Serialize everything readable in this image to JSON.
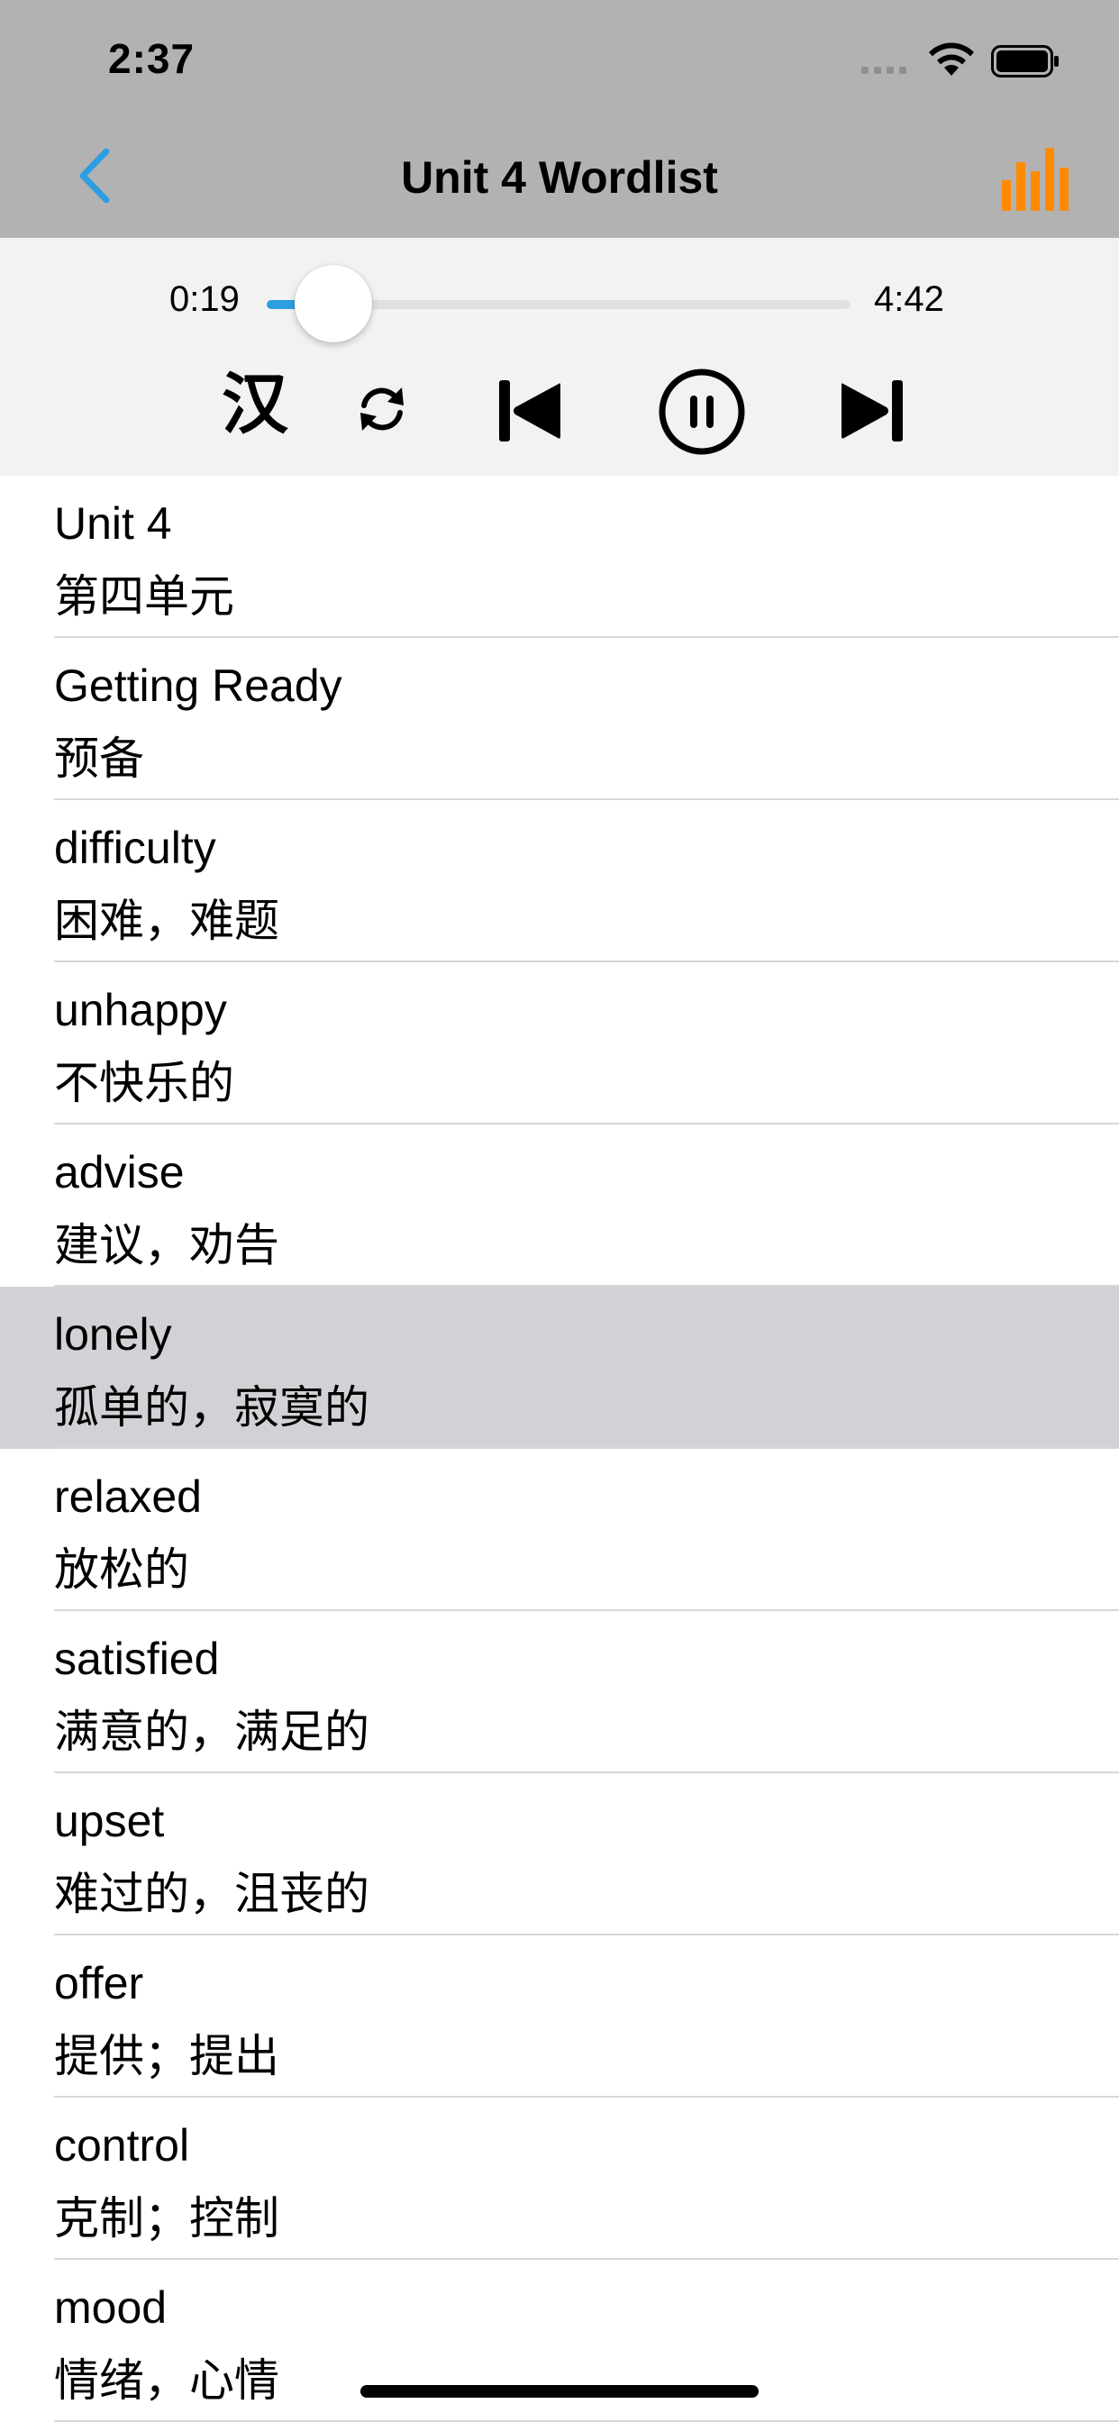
{
  "status_bar": {
    "time": "2:37"
  },
  "nav": {
    "title": "Unit 4 Wordlist"
  },
  "player": {
    "current_time": "0:19",
    "total_time": "4:42",
    "progress": 0.068,
    "han_label": "汉"
  },
  "colors": {
    "accent_blue": "#2d9fe0",
    "chart_orange": "#ff8a00",
    "selected_row": "#d2d2d6"
  },
  "icons": [
    "back-chevron-icon",
    "bar-chart-icon",
    "repeat-icon",
    "skip-back-icon",
    "pause-icon",
    "skip-forward-icon"
  ],
  "words": [
    {
      "word": "Unit 4",
      "meaning": "第四单元"
    },
    {
      "word": "Getting Ready",
      "meaning": "预备"
    },
    {
      "word": "difficulty",
      "meaning": "困难，难题"
    },
    {
      "word": "unhappy",
      "meaning": "不快乐的"
    },
    {
      "word": "advise",
      "meaning": "建议，劝告"
    },
    {
      "word": "lonely",
      "meaning": "孤单的，寂寞的",
      "selected": true
    },
    {
      "word": "relaxed",
      "meaning": "放松的"
    },
    {
      "word": "satisfied",
      "meaning": "满意的，满足的"
    },
    {
      "word": "upset",
      "meaning": "难过的，沮丧的"
    },
    {
      "word": "offer",
      "meaning": "提供；提出"
    },
    {
      "word": "control",
      "meaning": "克制；控制"
    },
    {
      "word": "mood",
      "meaning": "情绪，心情"
    }
  ]
}
